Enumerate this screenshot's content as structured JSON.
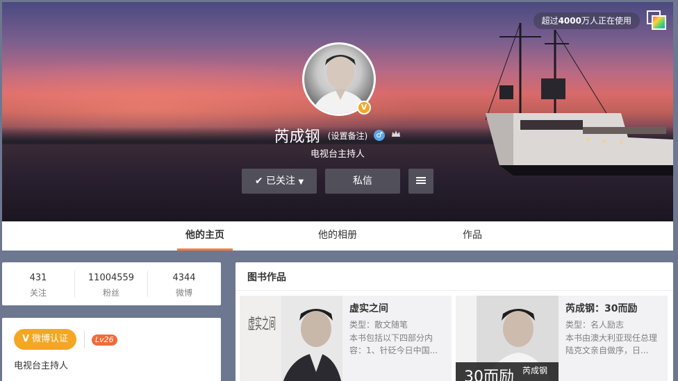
{
  "cover": {
    "user_count_prefix": "超过",
    "user_count_num": "4000",
    "user_count_suffix": "万人正在使用"
  },
  "profile": {
    "name": "芮成钢",
    "remark": "(设置备注)",
    "gender_symbol": "♂",
    "description": "电视台主持人",
    "verified_mark": "V"
  },
  "actions": {
    "follow_label": "已关注",
    "message_label": "私信"
  },
  "tabs": [
    {
      "label": "他的主页"
    },
    {
      "label": "他的相册"
    },
    {
      "label": "作品"
    }
  ],
  "stats": [
    {
      "num": "431",
      "label": "关注"
    },
    {
      "num": "11004559",
      "label": "粉丝"
    },
    {
      "num": "4344",
      "label": "微博"
    }
  ],
  "info": {
    "verify_mark": "V",
    "verify_label": "微博认证",
    "level": "Lv26",
    "description": "电视台主持人"
  },
  "books": {
    "title": "图书作品",
    "items": [
      {
        "title": "虚实之间",
        "type": "类型：散文随笔",
        "desc": "本书包括以下四部分内容：1、针砭今日中国...",
        "cover_text": "虚实之间"
      },
      {
        "title": "芮成钢：30而励",
        "type": "类型：名人励志",
        "desc": "本书由澳大利亚现任总理陆克文亲自做序，日...",
        "cover_text": "30而励",
        "cover_name": "芮成钢"
      }
    ]
  },
  "colors": {
    "accent": "#fa7d3c",
    "verify": "#f5a623",
    "level": "#f26b3a",
    "page_bg": "#6e7790"
  }
}
